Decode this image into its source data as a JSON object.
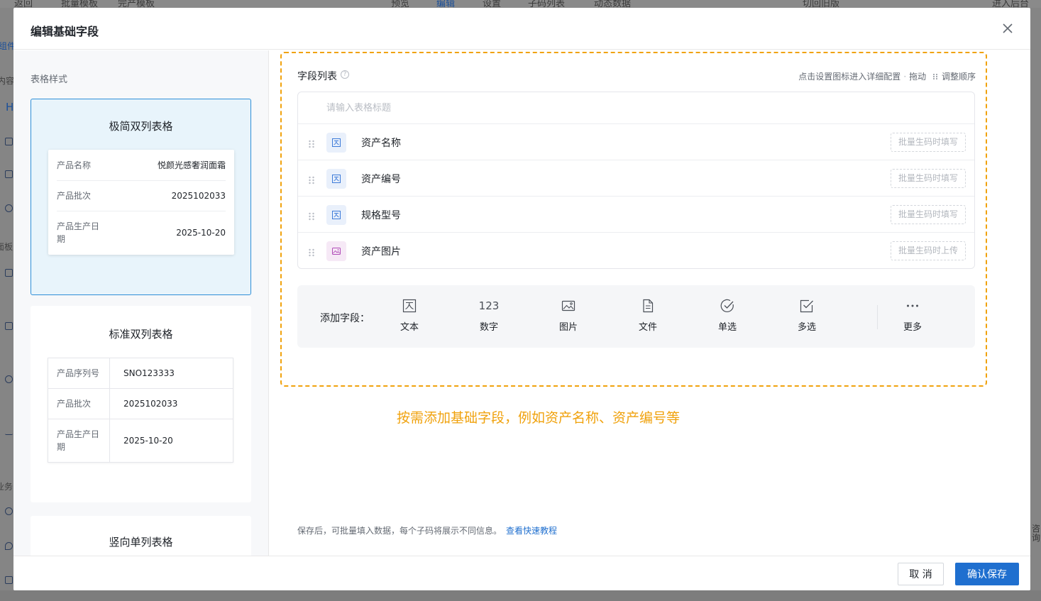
{
  "background": {
    "topbar": [
      "返回",
      "批量模板",
      "完产模板",
      "预览",
      "编辑",
      "设置",
      "子码列表",
      "动态数据",
      "切回旧版",
      "进入后台"
    ],
    "left_fragments": [
      "组件",
      "内容",
      "H",
      "面板",
      "业务"
    ],
    "right_fragments": [
      "咨询"
    ]
  },
  "modal": {
    "title": "编辑基础字段",
    "left": {
      "label": "表格样式",
      "cards": [
        {
          "title": "极简双列表格",
          "rows": [
            {
              "k": "产品名称",
              "v": "悦颜光感奢润面霜"
            },
            {
              "k": "产品批次",
              "v": "2025102033"
            },
            {
              "k": "产品生产日期",
              "v": "2025-10-20"
            }
          ]
        },
        {
          "title": "标准双列表格",
          "rows": [
            {
              "k": "产品序列号",
              "v": "SNO123333"
            },
            {
              "k": "产品批次",
              "v": "2025102033"
            },
            {
              "k": "产品生产日期",
              "v": "2025-10-20"
            }
          ]
        },
        {
          "title": "竖向单列表格"
        }
      ]
    },
    "right": {
      "field_list_title": "字段列表",
      "help_icon": "?",
      "hint_text": "点击设置图标进入详细配置",
      "hint_drag": "拖动",
      "hint_order": "调整顺序",
      "table_title_placeholder": "请输入表格标题",
      "fields": [
        {
          "name": "资产名称",
          "icon": "text-icon",
          "tag": "批量生码时填写"
        },
        {
          "name": "资产编号",
          "icon": "text-icon",
          "tag": "批量生码时填写"
        },
        {
          "name": "规格型号",
          "icon": "text-icon",
          "tag": "批量生码时填写"
        },
        {
          "name": "资产图片",
          "icon": "image-icon",
          "tag": "批量生码时上传"
        }
      ],
      "add_label": "添加字段：",
      "add_types": [
        {
          "label": "文本",
          "icon": "text-icon"
        },
        {
          "label": "数字",
          "icon": "number-icon",
          "glyph": "123"
        },
        {
          "label": "图片",
          "icon": "image-icon"
        },
        {
          "label": "文件",
          "icon": "file-icon"
        },
        {
          "label": "单选",
          "icon": "radio-check-icon"
        },
        {
          "label": "多选",
          "icon": "checkbox-icon"
        },
        {
          "label": "更多",
          "icon": "more-icon"
        }
      ],
      "annotation": "按需添加基础字段，例如资产名称、资产编号等",
      "save_note": "保存后，可批量填入数据，每个子码将展示不同信息。",
      "tutorial_link": "查看快速教程"
    },
    "footer": {
      "cancel": "取 消",
      "confirm": "确认保存"
    }
  },
  "colors": {
    "accent": "#1f6fcf",
    "selected_border": "#2f8fd8",
    "annotation": "#f0a20d"
  }
}
